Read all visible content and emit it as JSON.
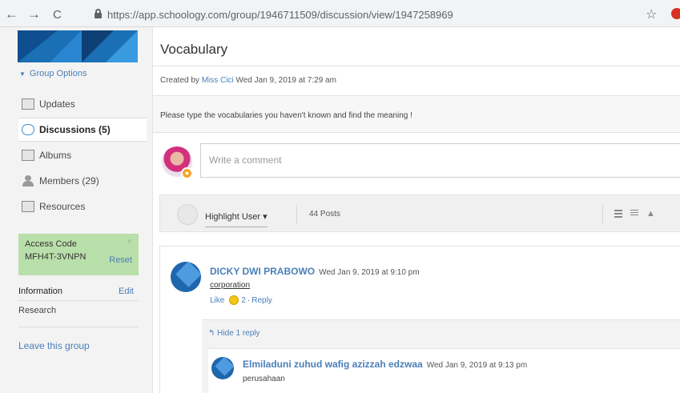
{
  "browser": {
    "back": "←",
    "forward": "→",
    "reload": "C",
    "url_host": "https://app.schoology.com",
    "url_path": "/group/1946711509/discussion/view/1947258969",
    "bookmark": "☆"
  },
  "sidebar": {
    "group_options": "Group Options",
    "items": [
      {
        "label": "Updates",
        "icon": "updates-icon"
      },
      {
        "label": "Discussions (5)",
        "icon": "discussion-icon"
      },
      {
        "label": "Albums",
        "icon": "albums-icon"
      },
      {
        "label": "Members (29)",
        "icon": "members-icon"
      },
      {
        "label": "Resources",
        "icon": "resources-icon"
      }
    ],
    "access_code": {
      "title": "Access Code",
      "code": "MFH4T-3VNPN",
      "reset": "Reset",
      "close": "×"
    },
    "information": {
      "label": "Information",
      "edit": "Edit",
      "value": "Research"
    },
    "leave": "Leave this group"
  },
  "discussion": {
    "title": "Vocabulary",
    "created_prefix": "Created by",
    "author": "Miss Cici",
    "created_date": "Wed Jan 9, 2019 at 7:29 am",
    "description": "Please type the vocabularies you haven't known and find the meaning !",
    "comment_placeholder": "Write a comment",
    "toolbar": {
      "highlight": "Highlight User ▾",
      "posts": "44 Posts"
    }
  },
  "posts": [
    {
      "name": "DICKY DWI PRABOWO",
      "date": "Wed Jan 9, 2019 at 9:10 pm",
      "text": "corporation",
      "like": "Like",
      "like_count": "2",
      "reply": "Reply",
      "hide_replies": "Hide 1 reply",
      "replies": [
        {
          "name": "Elmiladuni zuhud wafig azizzah edzwaa",
          "date": "Wed Jan 9, 2019 at 9:13 pm",
          "text": "perusahaan"
        }
      ]
    }
  ],
  "colors": {
    "brand_blue": "#1a6fb5",
    "link": "#4a7fb8",
    "access_bg": "#b9dfaa"
  }
}
